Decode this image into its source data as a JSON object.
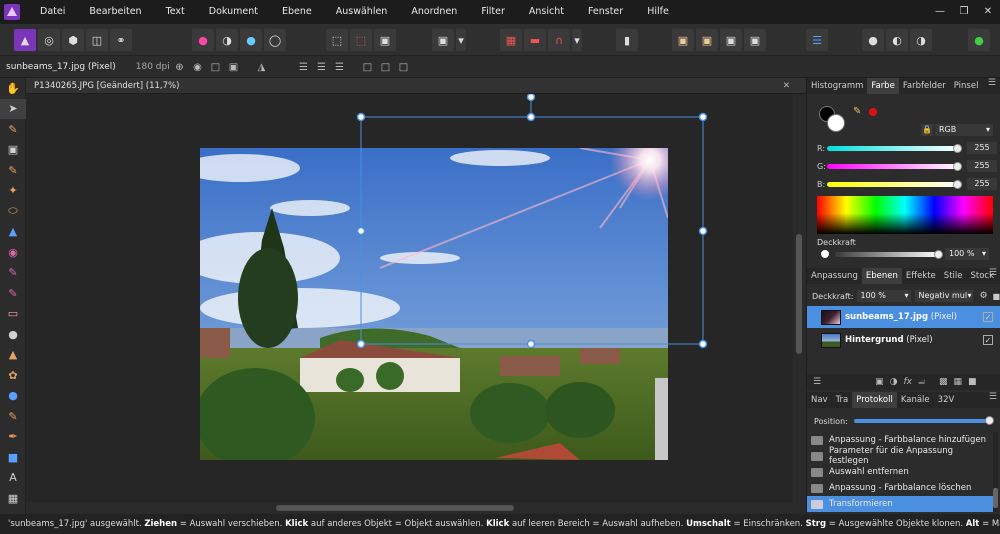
{
  "menubar": {
    "items": [
      "Datei",
      "Bearbeiten",
      "Text",
      "Dokument",
      "Ebene",
      "Auswählen",
      "Anordnen",
      "Filter",
      "Ansicht",
      "Fenster",
      "Hilfe"
    ]
  },
  "context": {
    "filename": "sunbeams_17.jpg (Pixel)",
    "dpi": "180 dpi"
  },
  "document": {
    "tab_title": "P1340265.JPG [Geändert] (11,7%)"
  },
  "panels": {
    "top_tabs": [
      "Histogramm",
      "Farbe",
      "Farbfelder",
      "Pinsel"
    ],
    "color": {
      "mode": "RGB",
      "r_label": "R:",
      "r_value": "255",
      "g_label": "G:",
      "g_value": "255",
      "b_label": "B:",
      "b_value": "255",
      "opacity_label": "Deckkraft",
      "opacity_value": "100 %"
    },
    "layer_tabs": [
      "Anpassung",
      "Ebenen",
      "Effekte",
      "Stile",
      "Stock"
    ],
    "layers": {
      "opacity_label": "Deckkraft:",
      "opacity_value": "100 %",
      "blend_mode": "Negativ mult",
      "items": [
        {
          "name": "sunbeams_17.jpg",
          "suffix": "(Pixel)"
        },
        {
          "name": "Hintergrund",
          "suffix": "(Pixel)"
        }
      ]
    },
    "bottom_tabs": [
      "Nav",
      "Tra",
      "Protokoll",
      "Kanäle",
      "32V"
    ],
    "history": {
      "position_label": "Position:",
      "items": [
        "Anpassung - Farbbalance hinzufügen",
        "Parameter für die Anpassung festlegen",
        "Auswahl entfernen",
        "Anpassung - Farbbalance löschen",
        "Transformieren"
      ]
    }
  },
  "status": {
    "s1": "'sunbeams_17.jpg' ausgewählt.",
    "k1": "Ziehen",
    "s2": "= Auswahl verschieben.",
    "k2": "Klick",
    "s3": "auf anderes Objekt = Objekt auswählen.",
    "k3": "Klick",
    "s4": "auf leeren Bereich = Auswahl aufheben.",
    "k4": "Umschalt",
    "s5": "= Einschränken.",
    "k5": "Strg",
    "s6": "= Ausgewählte Objekte klonen.",
    "k6": "Alt",
    "s7": "= Magnetische Ausrichtung igr"
  },
  "colors": {
    "accent": "#4a8fe0",
    "selection": "#5aa0ff",
    "brand": "#7a35b8"
  }
}
